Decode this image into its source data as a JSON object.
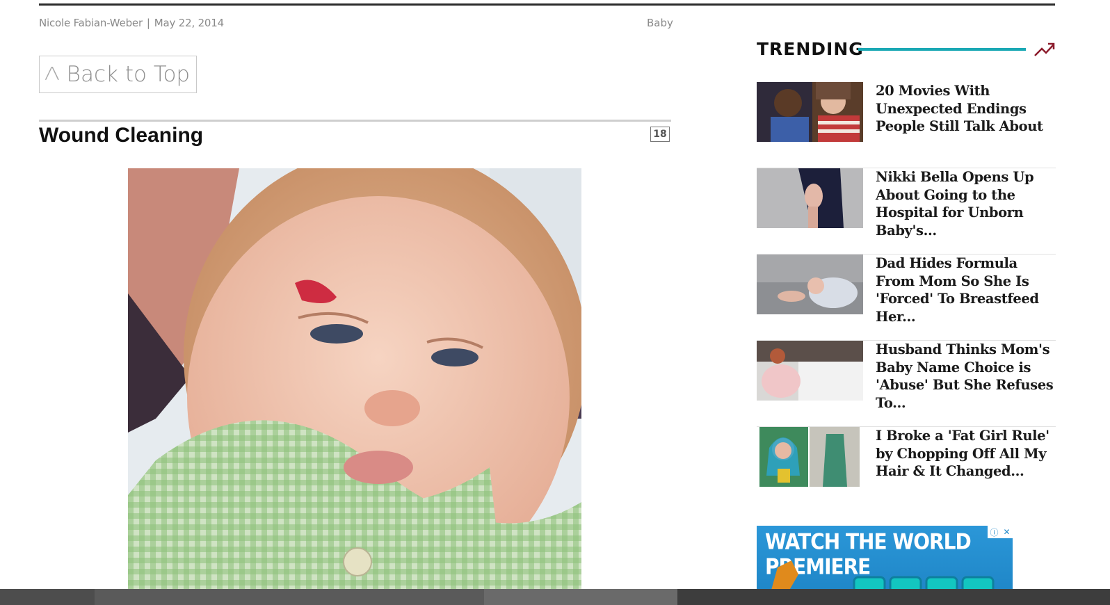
{
  "article": {
    "author": "Nicole Fabian-Weber",
    "separator": "|",
    "date": "May 22, 2014",
    "category": "Baby",
    "back_to_top_caret": "Λ",
    "back_to_top_label": "Back to Top",
    "section_title": "Wound Cleaning",
    "slide_number": "18"
  },
  "sidebar": {
    "trending_title": "TRENDING",
    "accent_color": "#1aa8b4",
    "trend_icon_color": "#8b1a2b",
    "items": [
      {
        "title": "20 Movies With Unexpected Endings People Still Talk About"
      },
      {
        "title": "Nikki Bella Opens Up About Going to the Hospital for Unborn Baby's..."
      },
      {
        "title": "Dad Hides Formula From Mom So She Is 'Forced' To Breastfeed Her..."
      },
      {
        "title": "Husband Thinks Mom's Baby Name Choice is 'Abuse' But She Refuses To..."
      },
      {
        "title": "I Broke a 'Fat Girl Rule' by Chopping Off All My Hair & It Changed..."
      }
    ]
  },
  "ad": {
    "headline": "WATCH THE WORLD PREMIERE",
    "info_glyph": "ⓘ",
    "close_glyph": "✕"
  }
}
